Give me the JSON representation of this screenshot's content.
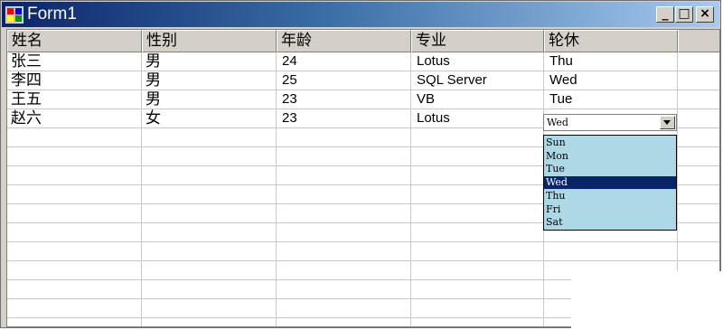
{
  "window": {
    "title": "Form1",
    "minimize_glyph": "_",
    "maximize_glyph": "□",
    "close_glyph": "×",
    "app_icon": "form-app-icon"
  },
  "grid": {
    "columns": [
      "姓名",
      "性别",
      "年龄",
      "专业",
      "轮休"
    ],
    "rows": [
      [
        "张三",
        "男",
        "24",
        "Lotus",
        "Thu"
      ],
      [
        "李四",
        "男",
        "25",
        "SQL Server",
        "Wed"
      ],
      [
        "王五",
        "男",
        "23",
        "VB",
        "Tue"
      ],
      [
        "赵六",
        "女",
        "23",
        "Lotus",
        ""
      ]
    ],
    "empty_row_count": 11
  },
  "combo": {
    "value": "Wed",
    "options": [
      "Sun",
      "Mon",
      "Tue",
      "Wed",
      "Thu",
      "Fri",
      "Sat"
    ],
    "selected_index": 3,
    "highlight_color": "#0a246a",
    "list_background": "#add8e6"
  }
}
